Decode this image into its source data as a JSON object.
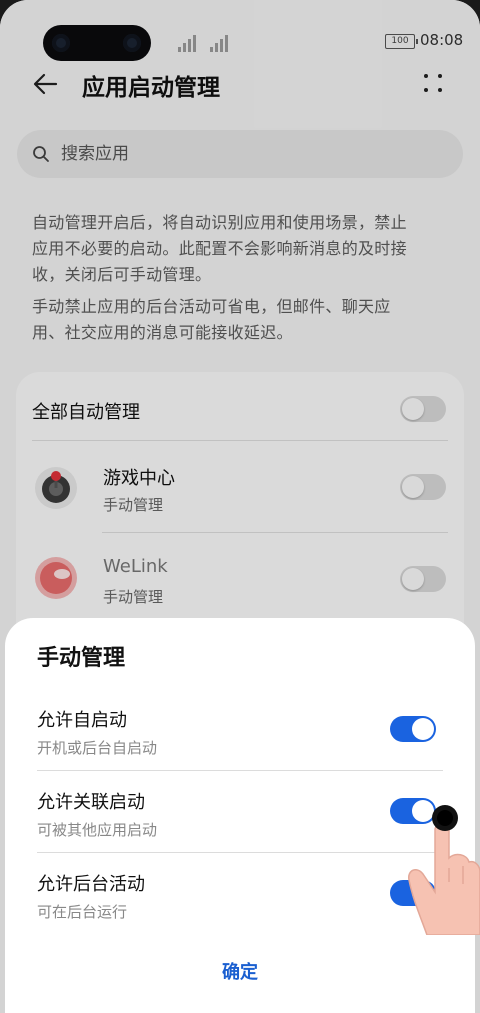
{
  "status_bar": {
    "time": "08:08",
    "battery": "100"
  },
  "header": {
    "title": "应用启动管理"
  },
  "search": {
    "placeholder": "搜索应用"
  },
  "description": {
    "paragraph1": [
      "自动管理开启后，将自动识别应用和使用场景，禁止",
      "应用不必要的启动。此配置不会影响新消息的及时接",
      "收，关闭后可手动管理。"
    ],
    "paragraph2": [
      "手动禁止应用的后台活动可省电，但邮件、聊天应",
      "用、社交应用的消息可能接收延迟。"
    ]
  },
  "list": {
    "all_auto_label": "全部自动管理",
    "apps": [
      {
        "name": "游戏中心",
        "mode": "手动管理"
      },
      {
        "name": "WeLink",
        "mode": "手动管理"
      }
    ]
  },
  "sheet": {
    "title": "手动管理",
    "options": [
      {
        "title": "允许自启动",
        "subtitle": "开机或后台自启动",
        "enabled": true
      },
      {
        "title": "允许关联启动",
        "subtitle": "可被其他应用启动",
        "enabled": true
      },
      {
        "title": "允许后台活动",
        "subtitle": "可在后台运行",
        "enabled": true
      }
    ],
    "confirm_label": "确定"
  },
  "colors": {
    "accent": "#1a63e0",
    "confirm": "#1a5fd0",
    "background": "#f1f1f1"
  }
}
